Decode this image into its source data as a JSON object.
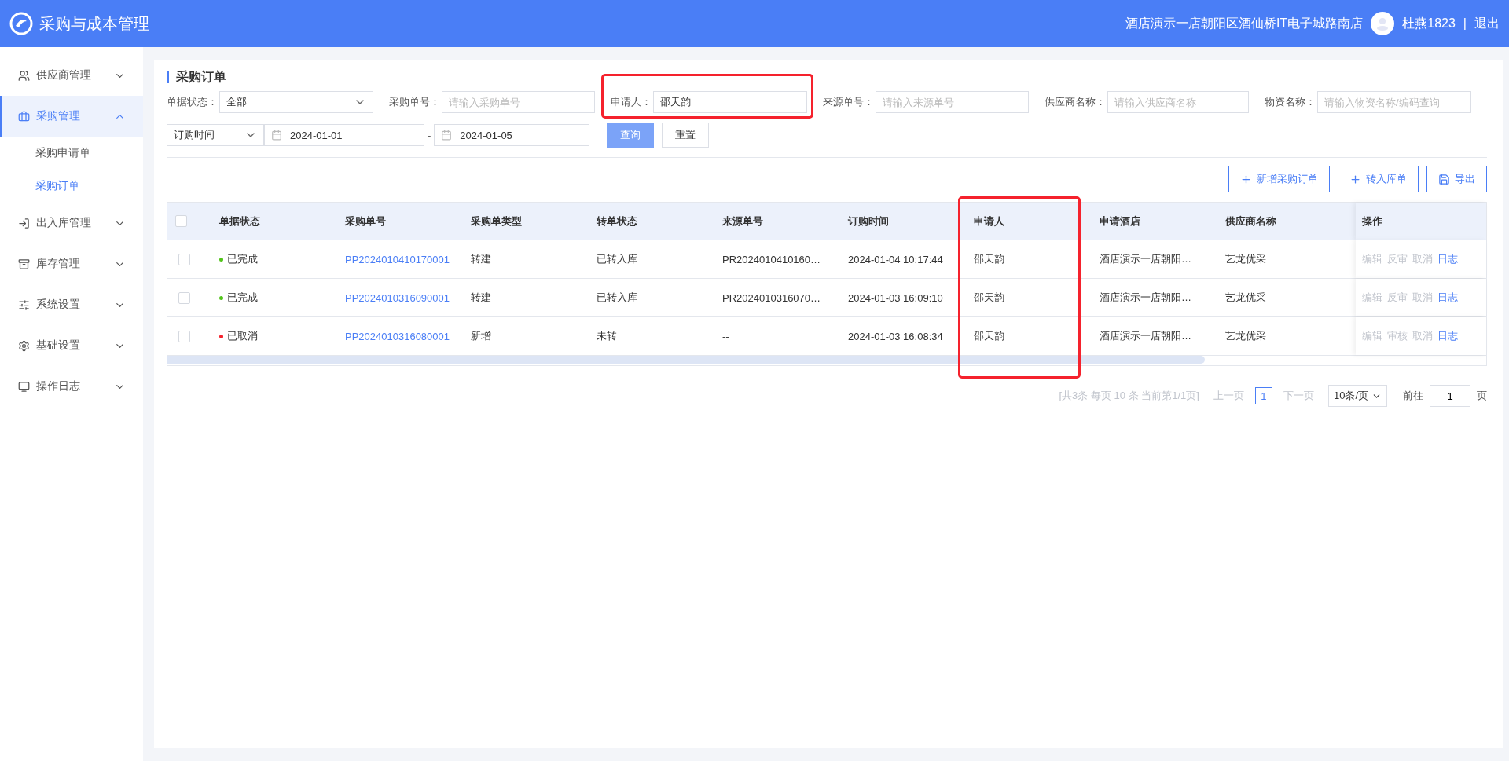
{
  "header": {
    "app_title": "采购与成本管理",
    "store": "酒店演示一店朝阳区酒仙桥IT电子城路南店",
    "user": "杜燕1823",
    "separator": "|",
    "logout": "退出"
  },
  "sidebar": {
    "items": [
      {
        "label": "供应商管理",
        "expanded": false,
        "selected": false
      },
      {
        "label": "采购管理",
        "expanded": true,
        "selected": true,
        "children": [
          {
            "label": "采购申请单",
            "selected": false
          },
          {
            "label": "采购订单",
            "selected": true
          }
        ]
      },
      {
        "label": "出入库管理",
        "expanded": false,
        "selected": false
      },
      {
        "label": "库存管理",
        "expanded": false,
        "selected": false
      },
      {
        "label": "系统设置",
        "expanded": false,
        "selected": false
      },
      {
        "label": "基础设置",
        "expanded": false,
        "selected": false
      },
      {
        "label": "操作日志",
        "expanded": false,
        "selected": false
      }
    ]
  },
  "page_title": "采购订单",
  "filters": [
    {
      "kind": "select",
      "label": "单据状态：",
      "value": "全部"
    },
    {
      "kind": "input",
      "label": "采购单号：",
      "placeholder": "请输入采购单号"
    },
    {
      "kind": "input",
      "label": "申请人：",
      "value": "邵天韵",
      "highlighted": true
    },
    {
      "kind": "input",
      "label": "来源单号：",
      "placeholder": "请输入来源单号"
    },
    {
      "kind": "input",
      "label": "供应商名称：",
      "placeholder": "请输入供应商名称"
    },
    {
      "kind": "input",
      "label": "物资名称：",
      "placeholder": "请输入物资名称/编码查询"
    }
  ],
  "date_filter": {
    "type": "订购时间",
    "from": "2024-01-01",
    "dash": "-",
    "to": "2024-01-05"
  },
  "search_buttons": [
    "查询",
    "重置"
  ],
  "actions": [
    {
      "kind": "add",
      "label": "新增采购订单"
    },
    {
      "kind": "add",
      "label": "转入库单"
    },
    {
      "kind": "export",
      "label": "导出"
    }
  ],
  "table": {
    "all_checked": false,
    "columns": [
      {
        "label": "单据状态",
        "highlighted": false
      },
      {
        "label": "采购单号",
        "highlighted": false
      },
      {
        "label": "采购单类型",
        "highlighted": false
      },
      {
        "label": "转单状态",
        "highlighted": false
      },
      {
        "label": "来源单号",
        "highlighted": false
      },
      {
        "label": "订购时间",
        "highlighted": false
      },
      {
        "label": "申请人",
        "highlighted": true
      },
      {
        "label": "申请酒店",
        "highlighted": false
      },
      {
        "label": "供应商名称",
        "highlighted": false
      }
    ],
    "ops_column": "操作",
    "rows": [
      {
        "checked": false,
        "color": "#52c41a",
        "cells": [
          "已完成",
          "PP2024010410170001",
          "转建",
          "已转入库",
          "PR2024010410160…",
          "2024-01-04 10:17:44",
          "邵天韵",
          "酒店演示一店朝阳…",
          "艺龙优采"
        ],
        "ops": [
          {
            "label": "编辑",
            "disabled": true
          },
          {
            "label": "反审",
            "disabled": true
          },
          {
            "label": "取消",
            "disabled": true
          },
          {
            "label": "日志",
            "disabled": false
          }
        ]
      },
      {
        "checked": false,
        "color": "#52c41a",
        "cells": [
          "已完成",
          "PP2024010316090001",
          "转建",
          "已转入库",
          "PR2024010316070…",
          "2024-01-03 16:09:10",
          "邵天韵",
          "酒店演示一店朝阳…",
          "艺龙优采"
        ],
        "ops": [
          {
            "label": "编辑",
            "disabled": true
          },
          {
            "label": "反审",
            "disabled": true
          },
          {
            "label": "取消",
            "disabled": true
          },
          {
            "label": "日志",
            "disabled": false
          }
        ]
      },
      {
        "checked": false,
        "color": "#f5222d",
        "cells": [
          "已取消",
          "PP2024010316080001",
          "新增",
          "未转",
          "--",
          "2024-01-03 16:08:34",
          "邵天韵",
          "酒店演示一店朝阳…",
          "艺龙优采"
        ],
        "ops": [
          {
            "label": "编辑",
            "disabled": true
          },
          {
            "label": "审核",
            "disabled": true
          },
          {
            "label": "取消",
            "disabled": true
          },
          {
            "label": "日志",
            "disabled": false
          }
        ]
      }
    ]
  },
  "pagination": {
    "summary": "[共3条 每页 10 条 当前第1/1页]",
    "prev": "上一页",
    "pages": [
      {
        "label": "1",
        "selected": true
      }
    ],
    "next": "下一页",
    "page_size": "10条/页",
    "goto_label": "前往",
    "goto_value": "1",
    "goto_unit": "页"
  }
}
